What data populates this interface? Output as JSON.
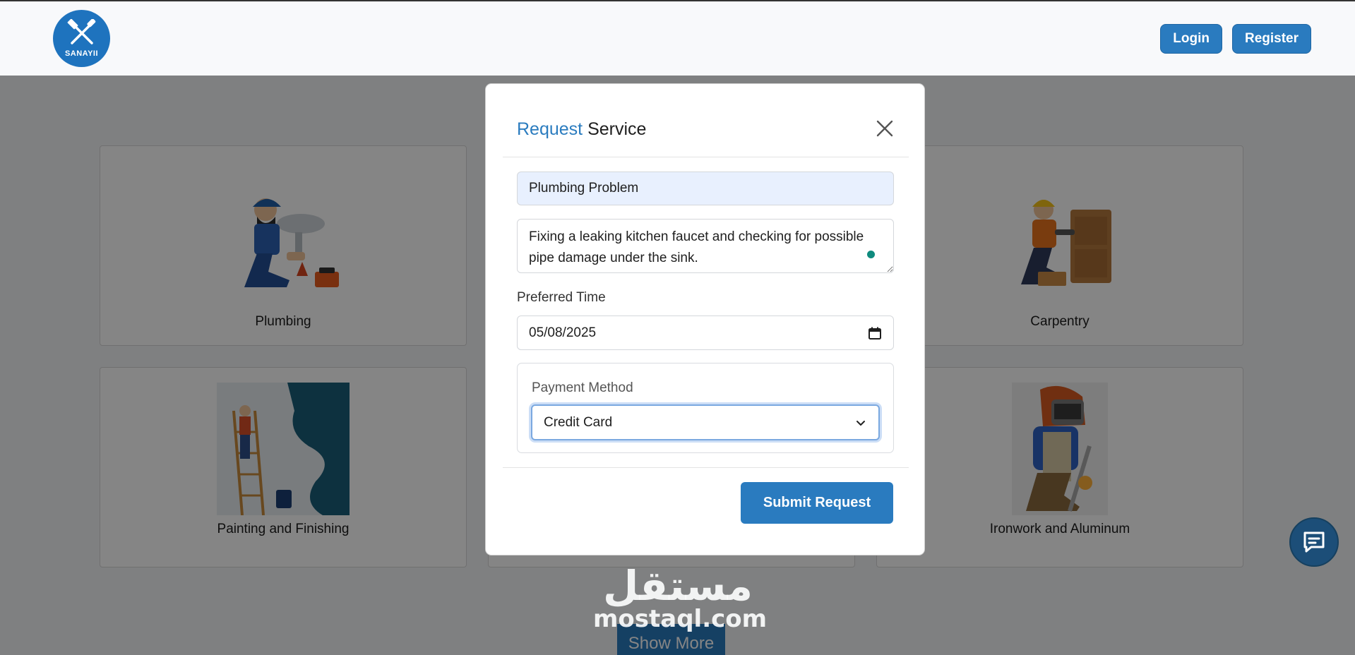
{
  "header": {
    "logo_text": "SANAYII",
    "login_label": "Login",
    "register_label": "Register"
  },
  "services": [
    {
      "label": "Plumbing"
    },
    {
      "label": "Carpentry"
    },
    {
      "label": "Painting and Finishing"
    },
    {
      "label": "Ironwork and Aluminum"
    }
  ],
  "show_more_label": "Show More",
  "watermark": {
    "arabic": "مستقل",
    "latin": "mostaql.com"
  },
  "modal": {
    "title_accent": "Request",
    "title_rest": " Service",
    "title_value": "Plumbing Problem",
    "description_value": "Fixing a leaking kitchen faucet and checking for possible pipe damage under the sink.",
    "preferred_time_label": "Preferred Time",
    "date_value": "05/08/2025",
    "payment_label": "Payment Method",
    "payment_selected": "Credit Card",
    "submit_label": "Submit Request"
  },
  "colors": {
    "brand": "#2a7bbf",
    "chat": "#1c4e78",
    "grammar_dot": "#0f8b7e"
  },
  "icons": [
    "logo-tools-icon",
    "close-icon",
    "calendar-icon",
    "chevron-down-icon",
    "chat-icon"
  ]
}
